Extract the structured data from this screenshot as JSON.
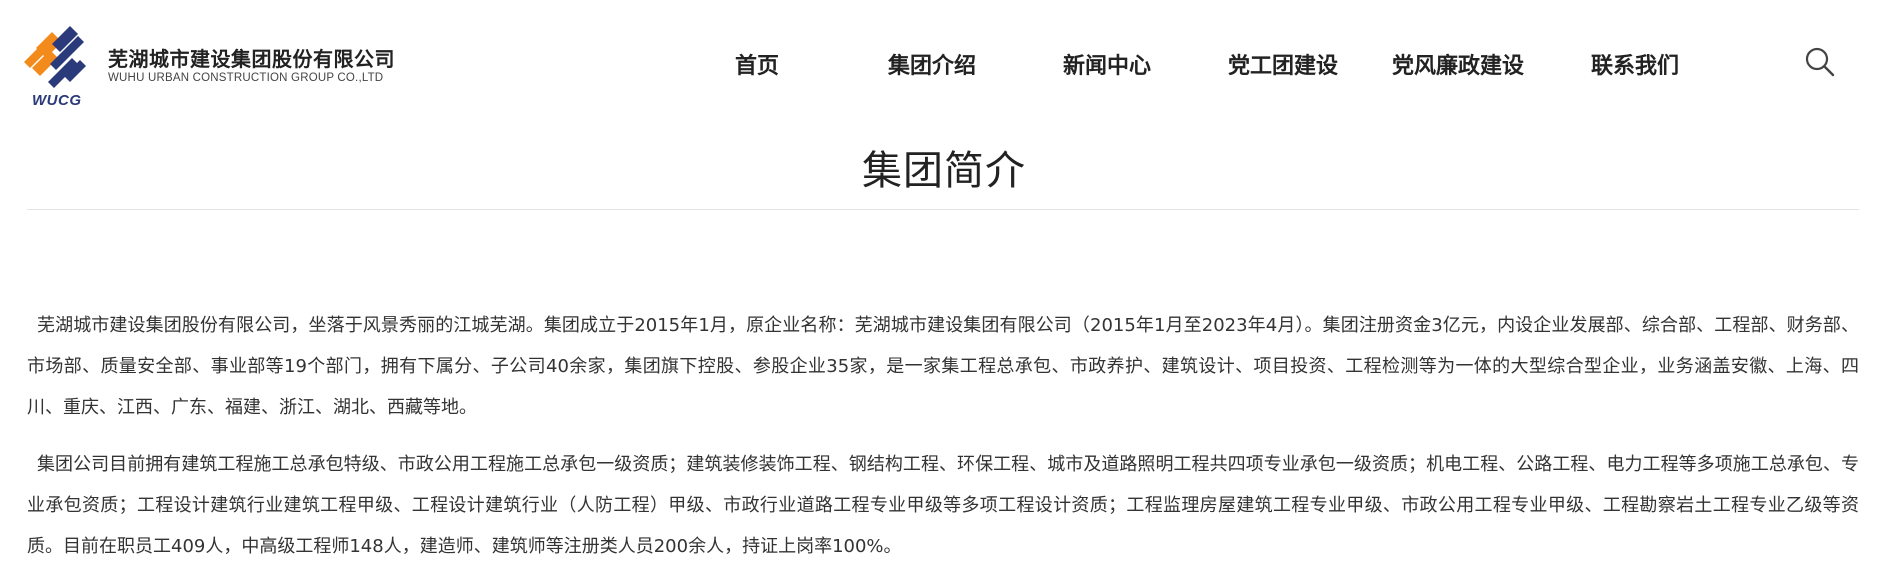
{
  "logo": {
    "name_cn": "芜湖城市建设集团股份有限公司",
    "name_en": "WUHU URBAN CONSTRUCTION GROUP CO.,LTD",
    "abbr": "WUCG",
    "colors": {
      "orange": "#f28b1b",
      "navy": "#2a3a7a"
    }
  },
  "nav": {
    "items": [
      {
        "label": "首页"
      },
      {
        "label": "集团介绍"
      },
      {
        "label": "新闻中心"
      },
      {
        "label": "党工团建设"
      },
      {
        "label": "党风廉政建设"
      },
      {
        "label": "联系我们"
      }
    ],
    "search_icon": "search-icon"
  },
  "page": {
    "title": "集团简介",
    "paragraphs": [
      "芜湖城市建设集团股份有限公司，坐落于风景秀丽的江城芜湖。集团成立于2015年1月，原企业名称：芜湖城市建设集团有限公司（2015年1月至2023年4月）。集团注册资金3亿元，内设企业发展部、综合部、工程部、财务部、市场部、质量安全部、事业部等19个部门，拥有下属分、子公司40余家，集团旗下控股、参股企业35家，是一家集工程总承包、市政养护、建筑设计、项目投资、工程检测等为一体的大型综合型企业，业务涵盖安徽、上海、四川、重庆、江西、广东、福建、浙江、湖北、西藏等地。",
      "集团公司目前拥有建筑工程施工总承包特级、市政公用工程施工总承包一级资质；建筑装修装饰工程、钢结构工程、环保工程、城市及道路照明工程共四项专业承包一级资质；机电工程、公路工程、电力工程等多项施工总承包、专业承包资质；工程设计建筑行业建筑工程甲级、工程设计建筑行业（人防工程）甲级、市政行业道路工程专业甲级等多项工程设计资质；工程监理房屋建筑工程专业甲级、市政公用工程专业甲级、工程勘察岩土工程专业乙级等资质。目前在职员工409人，中高级工程师148人，建造师、建筑师等注册类人员200余人，持证上岗率100%。"
    ]
  }
}
